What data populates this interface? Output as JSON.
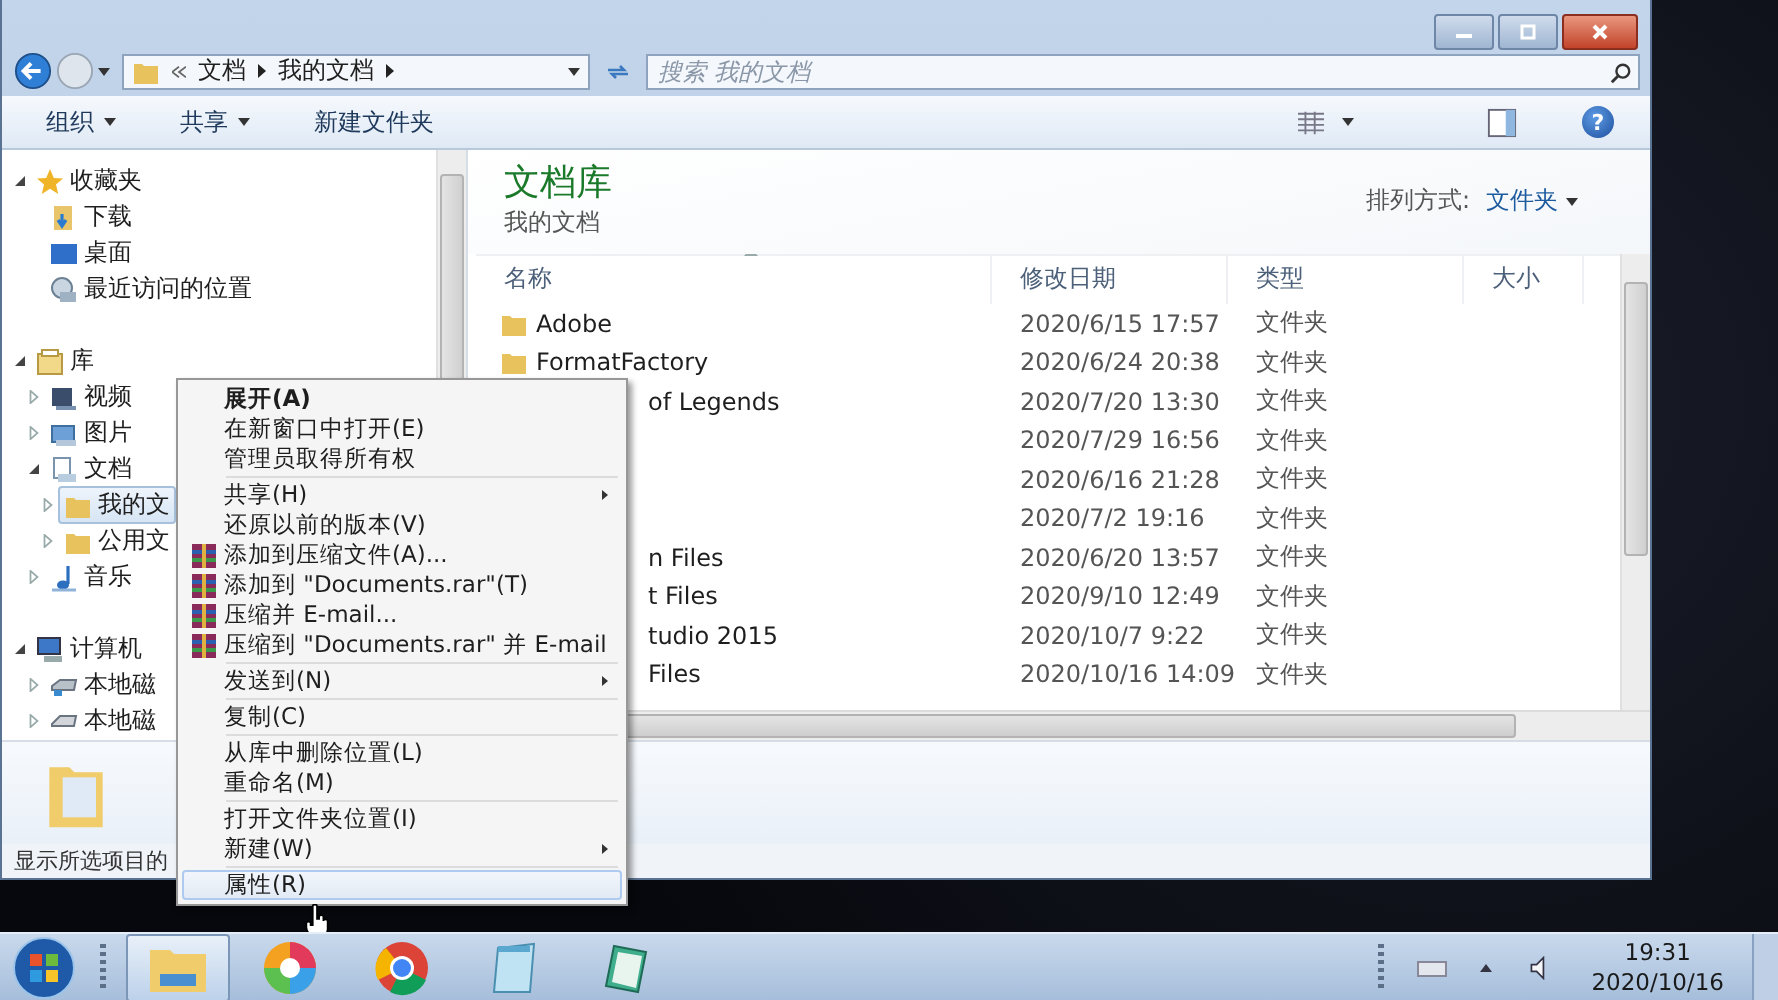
{
  "address_bar": {
    "crumbs": [
      "文档",
      "我的文档"
    ]
  },
  "search": {
    "placeholder": "搜索 我的文档"
  },
  "toolbar": {
    "items": [
      {
        "label": "组织",
        "dropdown": true
      },
      {
        "label": "共享",
        "dropdown": true
      },
      {
        "label": "新建文件夹",
        "dropdown": false
      }
    ],
    "help": "?"
  },
  "navigation": [
    {
      "label": "收藏夹",
      "kind": "star",
      "expanded": true,
      "selected": false,
      "children": [
        {
          "label": "下载",
          "kind": "download",
          "selected": false
        },
        {
          "label": "桌面",
          "kind": "desktop",
          "selected": false
        },
        {
          "label": "最近访问的位置",
          "kind": "recent",
          "selected": false
        }
      ]
    },
    {
      "label": "库",
      "kind": "library",
      "expanded": true,
      "selected": false,
      "children": [
        {
          "label": "视频",
          "kind": "video",
          "expanded": false,
          "selected": false
        },
        {
          "label": "图片",
          "kind": "picture",
          "expanded": false,
          "selected": false
        },
        {
          "label": "文档",
          "kind": "document",
          "expanded": true,
          "selected": false,
          "children": [
            {
              "label": "我的文",
              "kind": "folder",
              "expanded": false,
              "selected": true
            },
            {
              "label": "公用文",
              "kind": "folder",
              "expanded": false,
              "selected": false
            }
          ]
        },
        {
          "label": "音乐",
          "kind": "music",
          "expanded": false,
          "selected": false
        }
      ]
    },
    {
      "label": "计算机",
      "kind": "computer",
      "expanded": true,
      "selected": false,
      "children": [
        {
          "label": "本地磁",
          "kind": "disk",
          "expanded": false,
          "selected": false
        },
        {
          "label": "本地磁",
          "kind": "drive",
          "expanded": false,
          "selected": false
        }
      ]
    }
  ],
  "library": {
    "title": "文档库",
    "subtitle": "我的文档",
    "arrange_label": "排列方式:",
    "arrange_value": "文件夹"
  },
  "table": {
    "columns": [
      "名称",
      "修改日期",
      "类型",
      "大小"
    ],
    "rows": [
      {
        "name": "Adobe",
        "modified": "2020/6/15 17:57",
        "type": "文件夹"
      },
      {
        "name": "FormatFactory",
        "modified": "2020/6/24 20:38",
        "type": "文件夹"
      },
      {
        "name": "of Legends",
        "partial": true,
        "modified": "2020/7/20 13:30",
        "type": "文件夹"
      },
      {
        "modified": "2020/7/29 16:56",
        "type": "文件夹"
      },
      {
        "modified": "2020/6/16 21:28",
        "type": "文件夹"
      },
      {
        "modified": "2020/7/2 19:16",
        "type": "文件夹"
      },
      {
        "name": "n Files",
        "partial": true,
        "modified": "2020/6/20 13:57",
        "type": "文件夹"
      },
      {
        "name": "t Files",
        "partial": true,
        "modified": "2020/9/10 12:49",
        "type": "文件夹"
      },
      {
        "name": "tudio 2015",
        "partial": true,
        "modified": "2020/10/7 9:22",
        "type": "文件夹"
      },
      {
        "name": "Files",
        "partial": true,
        "modified": "2020/10/16 14:09",
        "type": "文件夹"
      }
    ]
  },
  "status_bar": {
    "text": "显示所选项目的"
  },
  "context_menu": {
    "groups": [
      [
        {
          "label": "展开(A)",
          "kind": "plain",
          "bold": true,
          "submenu": false,
          "highlighted": false
        },
        {
          "label": "在新窗口中打开(E)",
          "kind": "plain",
          "bold": false,
          "submenu": false,
          "highlighted": false
        },
        {
          "label": "管理员取得所有权",
          "kind": "plain",
          "bold": false,
          "submenu": false,
          "highlighted": false
        }
      ],
      [
        {
          "label": "共享(H)",
          "kind": "plain",
          "bold": false,
          "submenu": true,
          "highlighted": false
        },
        {
          "label": "还原以前的版本(V)",
          "kind": "plain",
          "bold": false,
          "submenu": false,
          "highlighted": false
        },
        {
          "label": "添加到压缩文件(A)...",
          "kind": "archive",
          "bold": false,
          "submenu": false,
          "highlighted": false
        },
        {
          "label": "添加到 \"Documents.rar\"(T)",
          "kind": "archive",
          "bold": false,
          "submenu": false,
          "highlighted": false
        },
        {
          "label": "压缩并 E-mail...",
          "kind": "archive",
          "bold": false,
          "submenu": false,
          "highlighted": false
        },
        {
          "label": "压缩到 \"Documents.rar\" 并 E-mail",
          "kind": "archive",
          "bold": false,
          "submenu": false,
          "highlighted": false
        }
      ],
      [
        {
          "label": "发送到(N)",
          "kind": "plain",
          "bold": false,
          "submenu": true,
          "highlighted": false
        }
      ],
      [
        {
          "label": "复制(C)",
          "kind": "plain",
          "bold": false,
          "submenu": false,
          "highlighted": false
        }
      ],
      [
        {
          "label": "从库中删除位置(L)",
          "kind": "plain",
          "bold": false,
          "submenu": false,
          "highlighted": false
        },
        {
          "label": "重命名(M)",
          "kind": "plain",
          "bold": false,
          "submenu": false,
          "highlighted": false
        }
      ],
      [
        {
          "label": "打开文件夹位置(I)",
          "kind": "plain",
          "bold": false,
          "submenu": false,
          "highlighted": false
        },
        {
          "label": "新建(W)",
          "kind": "plain",
          "bold": false,
          "submenu": true,
          "highlighted": false
        }
      ],
      [
        {
          "label": "属性(R)",
          "kind": "plain",
          "bold": false,
          "submenu": false,
          "highlighted": true
        }
      ]
    ]
  },
  "taskbar": {
    "apps": [
      {
        "kind": "explorer",
        "active": true
      },
      {
        "kind": "pinwheel",
        "active": false
      },
      {
        "kind": "browser",
        "active": false
      },
      {
        "kind": "notepad",
        "active": false
      },
      {
        "kind": "notebook",
        "active": false
      }
    ],
    "time": "19:31",
    "date": "2020/10/16"
  }
}
